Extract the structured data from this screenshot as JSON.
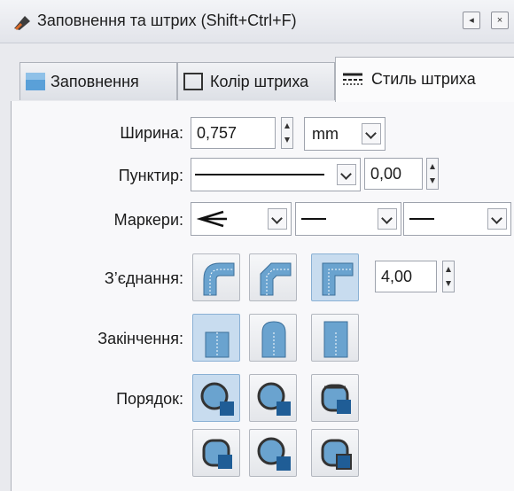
{
  "window": {
    "title": "Заповнення та штрих (Shift+Ctrl+F)",
    "button_min": "◂",
    "button_close": "×"
  },
  "tabs": [
    {
      "label": "Заповнення",
      "icon": "fill-tab-icon",
      "active": false
    },
    {
      "label": "Колір штриха",
      "icon": "stroke-paint-tab-icon",
      "active": false
    },
    {
      "label": "Стиль штриха",
      "icon": "stroke-style-tab-icon",
      "active": true
    }
  ],
  "width": {
    "label": "Ширина:",
    "value": "0,757",
    "unit": "mm"
  },
  "dash": {
    "label": "Пунктир:",
    "offset": "0,00"
  },
  "markers": {
    "label": "Маркери:"
  },
  "join": {
    "label": "З’єднання:",
    "miter_limit": "4,00",
    "options": [
      "round-join-icon",
      "bevel-join-icon",
      "miter-join-icon"
    ],
    "selected": 2
  },
  "cap": {
    "label": "Закінчення:",
    "options": [
      "butt-cap-icon",
      "round-cap-icon",
      "square-cap-icon"
    ],
    "selected": 0
  },
  "order": {
    "label": "Порядок:",
    "options": [
      "order-fill-stroke-markers-icon",
      "order-stroke-fill-markers-icon",
      "order-fill-markers-stroke-icon",
      "order-markers-fill-stroke-icon",
      "order-stroke-markers-fill-icon",
      "order-markers-stroke-fill-icon"
    ],
    "selected": 0
  },
  "colors": {
    "accent": "#2f86c6",
    "pressed": "#c8dcef"
  }
}
